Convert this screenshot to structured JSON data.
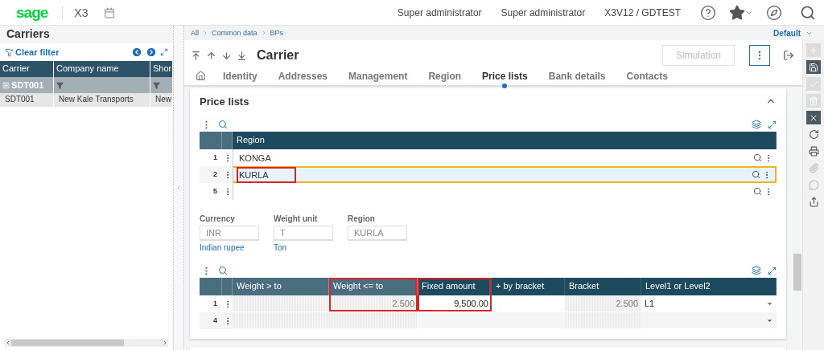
{
  "top_bar": {
    "logo": "sage",
    "app": "X3",
    "user_items": [
      "Super administrator",
      "Super administrator",
      "X3V12 / GDTEST"
    ]
  },
  "left_panel": {
    "title": "Carriers",
    "clear_filter": "Clear filter",
    "columns": [
      "Carrier",
      "Company name",
      "Shor"
    ],
    "filter_value": "SDT001",
    "rows": [
      [
        "SDT001",
        "New Kale Transports",
        "New"
      ]
    ]
  },
  "breadcrumb": {
    "items": [
      "All",
      "Common data",
      "BPs"
    ],
    "view": "Default"
  },
  "header": {
    "title": "Carrier",
    "simulation": {
      "label": "Simulation",
      "disabled": true
    }
  },
  "tabs": [
    {
      "label": "Identity",
      "selected": false
    },
    {
      "label": "Addresses",
      "selected": false
    },
    {
      "label": "Management",
      "selected": false
    },
    {
      "label": "Region",
      "selected": false
    },
    {
      "label": "Price lists",
      "selected": true
    },
    {
      "label": "Bank details",
      "selected": false
    },
    {
      "label": "Contacts",
      "selected": false
    }
  ],
  "section": {
    "title": "Price lists",
    "expanded": true,
    "region_table": {
      "column": "Region",
      "rows": [
        {
          "num": "1",
          "region": "KONGA",
          "selected": false,
          "annotated": false
        },
        {
          "num": "2",
          "region": "KURLA",
          "selected": true,
          "annotated": true
        },
        {
          "num": "5",
          "selected": false,
          "annotated": false
        }
      ]
    },
    "fields": [
      {
        "label": "Currency",
        "value": "INR",
        "description": "Indian rupee"
      },
      {
        "label": "Weight unit",
        "value": "T",
        "description": "Ton"
      },
      {
        "label": "Region",
        "value": "KURLA"
      }
    ],
    "price_table": {
      "columns": [
        {
          "label": "Weight > to",
          "dimmed": true,
          "readonly": true,
          "annotated": false,
          "kind": "number"
        },
        {
          "label": "Weight <= to",
          "dimmed": true,
          "readonly": true,
          "annotated": true,
          "kind": "number"
        },
        {
          "label": "Fixed amount",
          "dimmed": false,
          "readonly": false,
          "annotated": true,
          "kind": "number"
        },
        {
          "label": "+ by bracket",
          "dimmed": false,
          "readonly": false,
          "annotated": false,
          "kind": "number"
        },
        {
          "label": "Bracket",
          "dimmed": false,
          "readonly": true,
          "annotated": false,
          "kind": "number"
        },
        {
          "label": "Level1 or Level2",
          "dimmed": false,
          "readonly": false,
          "annotated": false,
          "kind": "dropdown"
        }
      ],
      "rows": [
        {
          "num": "1",
          "cells": [
            null,
            "2.500",
            "9,500.00",
            null,
            "2.500",
            "L1"
          ]
        },
        {
          "num": "4"
        }
      ]
    }
  },
  "actions": [
    {
      "kind": "add",
      "disabled": true
    },
    {
      "kind": "save",
      "disabled": false
    },
    {
      "kind": "ok",
      "disabled": true
    },
    {
      "kind": "delete",
      "disabled": true
    },
    {
      "kind": "cancel",
      "disabled": false
    },
    {
      "kind": "refresh",
      "disabled": false
    },
    {
      "kind": "print",
      "disabled": false
    },
    {
      "kind": "attach",
      "disabled": true
    },
    {
      "kind": "comment",
      "disabled": true
    },
    {
      "kind": "share",
      "disabled": false
    }
  ]
}
